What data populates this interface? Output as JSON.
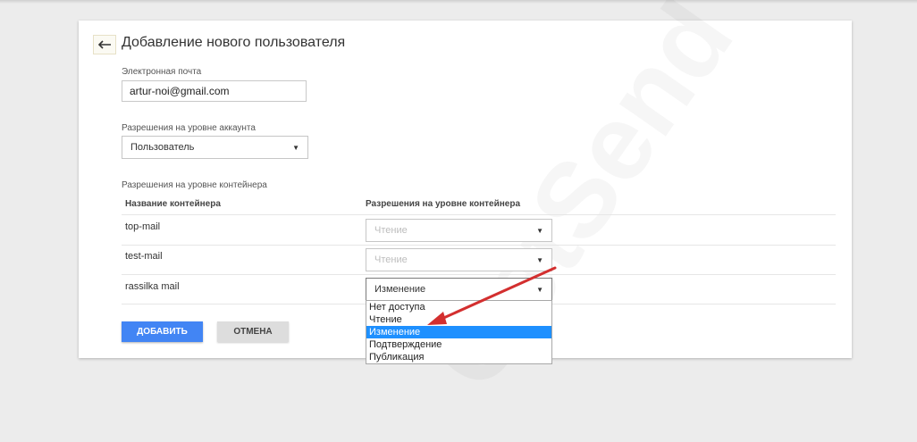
{
  "page": {
    "title": "Добавление нового пользователя",
    "watermark": "GetSend"
  },
  "email": {
    "label": "Электронная почта",
    "value": "artur-noi@gmail.com"
  },
  "account_permissions": {
    "label": "Разрешения на уровне аккаунта",
    "selected": "Пользователь"
  },
  "container_permissions": {
    "label": "Разрешения на уровне контейнера",
    "col_name": "Название контейнера",
    "col_permission": "Разрешения на уровне контейнера",
    "rows": [
      {
        "name": "top-mail",
        "permission": "Чтение"
      },
      {
        "name": "test-mail",
        "permission": "Чтение"
      },
      {
        "name": "rassilka mail",
        "permission": "Изменение"
      }
    ]
  },
  "dropdown": {
    "options": [
      "Нет доступа",
      "Чтение",
      "Изменение",
      "Подтверждение",
      "Публикация"
    ],
    "highlighted_index": 2,
    "highlight_color": "#1e90ff"
  },
  "actions": {
    "add_label": "ДОБАВИТЬ",
    "cancel_label": "ОТМЕНА"
  },
  "colors": {
    "primary": "#4285f4",
    "annotation_arrow": "#d32f2f"
  },
  "icons": {
    "back": "back-arrow-icon",
    "caret": "caret-down-icon"
  }
}
